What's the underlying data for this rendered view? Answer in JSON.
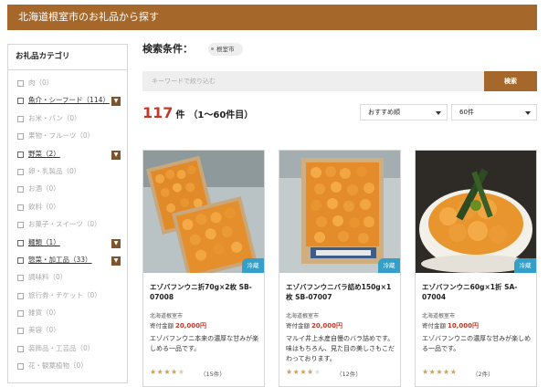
{
  "header": {
    "title": "北海道根室市のお礼品から探す"
  },
  "sidebar": {
    "title": "お礼品カテゴリ",
    "items": [
      {
        "label": "肉（0）",
        "active": false,
        "expand": false
      },
      {
        "label": "魚介・シーフード（114）",
        "active": true,
        "expand": true
      },
      {
        "label": "お米・パン（0）",
        "active": false,
        "expand": false
      },
      {
        "label": "果物・フルーツ（0）",
        "active": false,
        "expand": false
      },
      {
        "label": "野菜（2）",
        "active": true,
        "expand": true
      },
      {
        "label": "卵・乳製品（0）",
        "active": false,
        "expand": false
      },
      {
        "label": "お酒（0）",
        "active": false,
        "expand": false
      },
      {
        "label": "飲料（0）",
        "active": false,
        "expand": false
      },
      {
        "label": "お菓子・スイーツ（0）",
        "active": false,
        "expand": false
      },
      {
        "label": "麺類（1）",
        "active": true,
        "expand": true
      },
      {
        "label": "惣菜・加工品（33）",
        "active": true,
        "expand": true
      },
      {
        "label": "調味料（0）",
        "active": false,
        "expand": false
      },
      {
        "label": "旅行券・チケット（0）",
        "active": false,
        "expand": false
      },
      {
        "label": "雑貨（0）",
        "active": false,
        "expand": false
      },
      {
        "label": "美容（0）",
        "active": false,
        "expand": false
      },
      {
        "label": "装飾品・工芸品（0）",
        "active": false,
        "expand": false
      },
      {
        "label": "花・観葉植物（0）",
        "active": false,
        "expand": false
      }
    ],
    "expand_icon": "▼"
  },
  "conditions": {
    "label": "検索条件：",
    "tag": "根室市"
  },
  "search": {
    "placeholder": "キーワードで絞り込む",
    "button_label": "検索"
  },
  "results": {
    "count": "117",
    "unit": "件",
    "range": "（1〜60件目）"
  },
  "sort": {
    "selected": "おすすめ順"
  },
  "per_page": {
    "selected": "60件"
  },
  "products": [
    {
      "name": "エゾバフンウニ折70g×2枚 SB-07008",
      "location": "北海道根室市",
      "price_label": "寄付金額",
      "price": "20,000円",
      "description": "エゾバフンウニ本来の濃厚な甘みが楽しめる一品です。",
      "badge": "冷蔵",
      "rating": 4.5,
      "reviews": "（15件）"
    },
    {
      "name": "エゾバフンウニバラ詰め150g×1枚 SB-07007",
      "location": "北海道根室市",
      "price_label": "寄付金額",
      "price": "20,000円",
      "description": "マルイ井上水産自慢のバラ詰めです。味はもちろん、見た目の美しさもこだわっております。",
      "badge": "冷蔵",
      "rating": 4,
      "reviews": "（12件）"
    },
    {
      "name": "エゾバフンウニ60g×1折 SA-07004",
      "location": "北海道根室市",
      "price_label": "寄付金額",
      "price": "10,000円",
      "description": "エゾバフンウニの濃厚な甘みが楽しめる一品です。",
      "badge": "冷蔵",
      "rating": 5,
      "reviews": "（2件）"
    }
  ],
  "colors": {
    "brand": "#a5682a",
    "price": "#c0392b",
    "badge": "#34a0c9",
    "star": "#c9a066"
  }
}
